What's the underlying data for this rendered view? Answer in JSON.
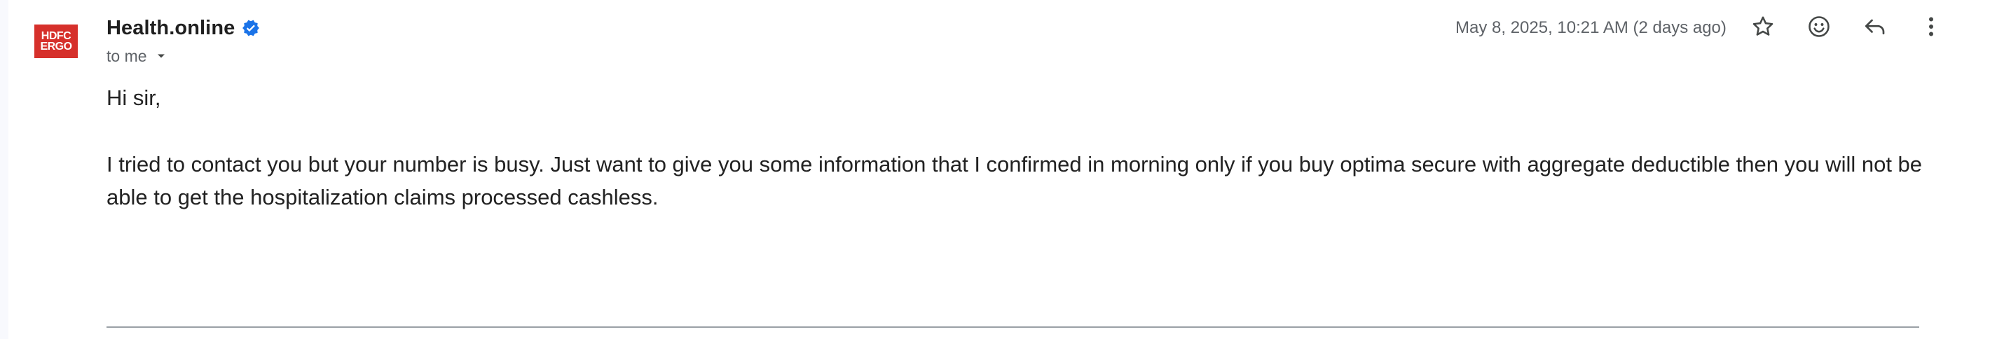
{
  "sender": {
    "avatar_text_line1": "HDFC",
    "avatar_text_line2": "ERGO",
    "name": "Health.online",
    "verified_icon": "verified-badge-icon"
  },
  "recipient": {
    "label": "to me",
    "dropdown_icon": "caret-down-icon"
  },
  "meta": {
    "date": "May 8, 2025, 10:21 AM (2 days ago)"
  },
  "actions": [
    {
      "name": "star",
      "icon": "star-icon"
    },
    {
      "name": "emoji",
      "icon": "emoji-icon"
    },
    {
      "name": "reply",
      "icon": "reply-icon"
    },
    {
      "name": "more",
      "icon": "more-vert-icon"
    }
  ],
  "body": {
    "greeting": "Hi sir,",
    "paragraph": "I tried to contact you but your number is busy. Just want to give you some information that I confirmed in morning only if you buy optima secure with aggregate deductible then you will not be able to get the hospitalization claims processed cashless."
  },
  "colors": {
    "avatar_bg": "#d6302b",
    "verified_blue": "#1a73e8",
    "icon_gray": "#444746",
    "meta_gray": "#5f6368"
  }
}
